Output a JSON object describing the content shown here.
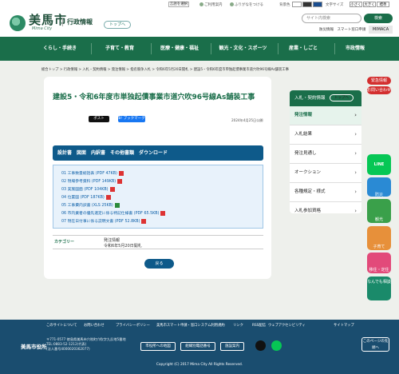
{
  "header": {
    "city_name": "美馬市",
    "city_en": "Mima City",
    "gov_label": "行政情報",
    "top_button": "トップへ",
    "util": {
      "lang": "言語を選択",
      "voice": "ご利用案内",
      "reading": "ふりがなをつける",
      "bg_color": "背景色",
      "font_size": "文字サイズ",
      "small": "小さく",
      "large": "大きく",
      "standard": "標準"
    },
    "search_placeholder": "サイト内検索",
    "search_button": "検索",
    "links": "防災情報　スマート窓口申請",
    "mimaca": "MIMACA"
  },
  "nav": [
    "くらし・手続き",
    "子育て・教育",
    "医療・健康・福祉",
    "観光・文化・スポーツ",
    "産業・しごと",
    "市政情報"
  ],
  "breadcrumb": "総合トップ > 行政情報 > 入札・契約情報 > 発注情報 > 指名競争入札 > 令和6年5月20日開札 > 建設5・令和6年度市単独起債事業市道穴吹96号線As舗装工事",
  "page": {
    "title": "建設5・令和6年度市単独起債事業市道穴吹96号線As舗装工事",
    "share_x": "ポスト",
    "share_fb": "B! ブックマーク 0",
    "published": "2024年4月25日公開",
    "tabs": "設計書　図面　内訳書　その他書類　ダウンロード",
    "files": [
      "01 工事数量総括表 (PDF 47KB)",
      "02 現場参考資料 (PDF 149KB)",
      "03 実施図面 (PDF 104KB)",
      "04 位置図 (PDF 187KB)",
      "05 工事費内訳書 (XLS 25KB)",
      "06 市内業者の優先選定に係る特記仕様書 (PDF 65.5KB)",
      "07 現在日付事に係る説明文書 (PDF 52.8KB)"
    ],
    "category_label": "カテゴリー",
    "category_value": "発注情報",
    "category_date": "令和6年5月20日開札",
    "back_button": "戻る"
  },
  "sidebar": {
    "header": "入札・契約情報",
    "top_button": "トップへ",
    "items": [
      "発注情報",
      "入札結果",
      "発注見通し",
      "オークション",
      "各種規定・様式",
      "入札参加資格"
    ]
  },
  "right_rail": {
    "urgent": "緊急情報",
    "faq": "お問い合わせ",
    "line": "LINE",
    "disaster": "防災",
    "sightseeing": "観光",
    "childcare": "子育て",
    "migration": "移住・定住",
    "consult": "なんでも相談"
  },
  "footer": {
    "links": [
      "このサイトについて",
      "お問い合わせ",
      "プライバシーポリシー",
      "美馬市スマート申請・窓口システム利用規約",
      "リンク",
      "RSS配信",
      "ウェブアクセシビリティ",
      "サイトマップ"
    ],
    "office": "美馬市役所",
    "address": [
      "〒771-0577 徳島県美馬市穴吹町穴吹字九反地5番地",
      "TEL:0883-52-1212(代表)",
      "(法人番号4000020362077)"
    ],
    "boxes": [
      "市役所への地図",
      "組織別電話番号",
      "施設案内"
    ],
    "top_link": "このページの先頭へ",
    "copyright": "Copyright (C) 2017 Mima City All Rights Reserved."
  }
}
